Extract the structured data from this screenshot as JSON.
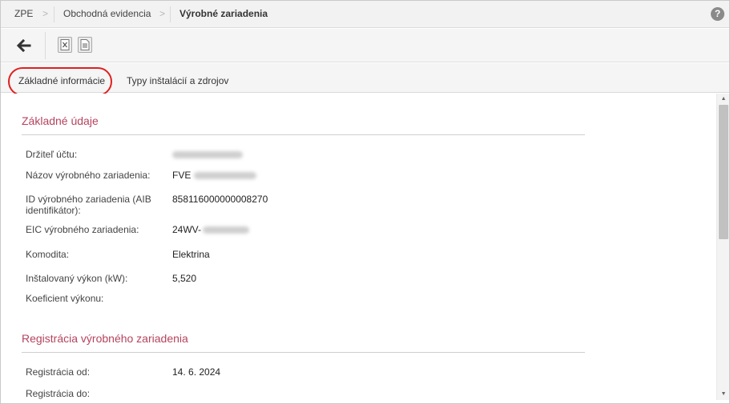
{
  "breadcrumb": {
    "items": [
      "ZPE",
      "Obchodná evidencia",
      "Výrobné zariadenia"
    ],
    "separator": ">"
  },
  "help": {
    "label": "?"
  },
  "toolbar": {
    "back_icon": "arrow-left-icon",
    "export_excel_icon": "excel-export-icon",
    "export_doc_icon": "document-export-icon"
  },
  "tabs": [
    {
      "label": "Základné informácie",
      "active": true
    },
    {
      "label": "Typy inštalácií a zdrojov",
      "active": false
    }
  ],
  "sections": [
    {
      "title": "Základné údaje",
      "fields": [
        {
          "label": "Držiteľ účtu:",
          "value": ""
        },
        {
          "label": "Názov výrobného zariadenia:",
          "value": "FVE"
        },
        {
          "label": "ID výrobného zariadenia (AIB identifikátor):",
          "value": "858116000000008270"
        },
        {
          "label": "EIC výrobného zariadenia:",
          "value": "24WV-"
        },
        {
          "label": "Komodita:",
          "value": "Elektrina"
        },
        {
          "label": "Inštalovaný výkon (kW):",
          "value": "5,520"
        },
        {
          "label": "Koeficient výkonu:",
          "value": ""
        }
      ]
    },
    {
      "title": "Registrácia výrobného zariadenia",
      "fields": [
        {
          "label": "Registrácia od:",
          "value": "14. 6. 2024"
        },
        {
          "label": "Registrácia do:",
          "value": ""
        }
      ]
    }
  ],
  "colors": {
    "section_title": "#b5435e",
    "tab_highlight": "#e02020"
  }
}
